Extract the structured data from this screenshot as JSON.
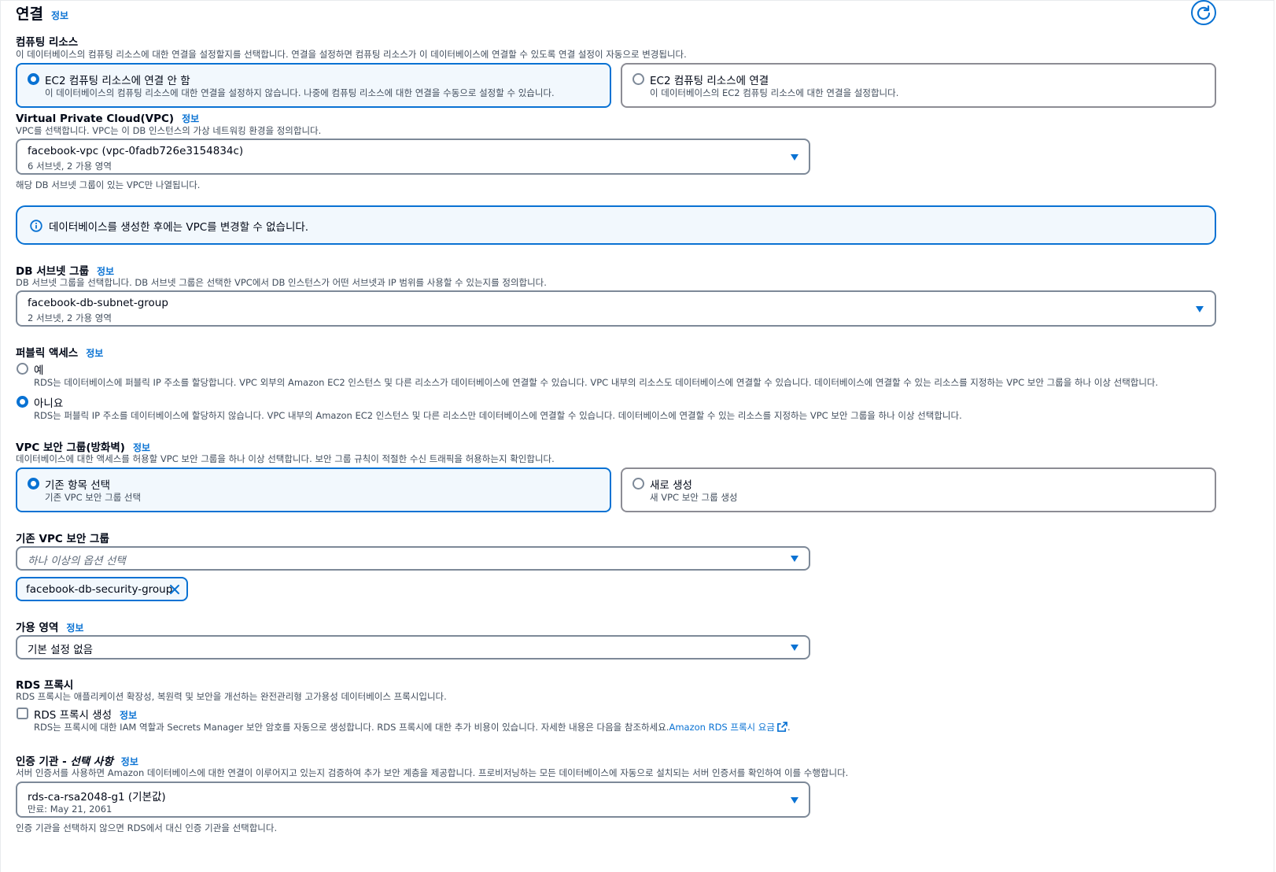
{
  "header": {
    "title": "연결",
    "info": "정보",
    "refresh_icon": "refresh-icon"
  },
  "compute": {
    "label": "컴퓨팅 리소스",
    "description": "이 데이터베이스의 컴퓨팅 리소스에 대한 연결을 설정할지를 선택합니다. 연결을 설정하면 컴퓨팅 리소스가 이 데이터베이스에 연결할 수 있도록 연결 설정이 자동으로 변경됩니다.",
    "options": [
      {
        "title": "EC2 컴퓨팅 리소스에 연결 안 함",
        "description": "이 데이터베이스의 컴퓨팅 리소스에 대한 연결을 설정하지 않습니다. 나중에 컴퓨팅 리소스에 대한 연결을 수동으로 설정할 수 있습니다.",
        "selected": true
      },
      {
        "title": "EC2 컴퓨팅 리소스에 연결",
        "description": "이 데이터베이스의 EC2 컴퓨팅 리소스에 대한 연결을 설정합니다.",
        "selected": false
      }
    ]
  },
  "vpc": {
    "label": "Virtual Private Cloud(VPC)",
    "info": "정보",
    "description": "VPC를 선택합니다. VPC는 이 DB 인스턴스의 가상 네트워킹 환경을 정의합니다.",
    "value": "facebook-vpc (vpc-0fadb726e3154834c)",
    "sub": "6 서브넷, 2 가용 영역",
    "hint": "해당 DB 서브넷 그룹이 있는 VPC만 나열됩니다.",
    "alert": "데이터베이스를 생성한 후에는 VPC를 변경할 수 없습니다."
  },
  "subnet": {
    "label": "DB 서브넷 그룹",
    "info": "정보",
    "description": "DB 서브넷 그룹을 선택합니다. DB 서브넷 그룹은 선택한 VPC에서 DB 인스턴스가 어떤 서브넷과 IP 범위를 사용할 수 있는지를 정의합니다.",
    "value": "facebook-db-subnet-group",
    "sub": "2 서브넷, 2 가용 영역"
  },
  "public_access": {
    "label": "퍼블릭 액세스",
    "info": "정보",
    "options": [
      {
        "title": "예",
        "description": "RDS는 데이터베이스에 퍼블릭 IP 주소를 할당합니다. VPC 외부의 Amazon EC2 인스턴스 및 다른 리소스가 데이터베이스에 연결할 수 있습니다. VPC 내부의 리소스도 데이터베이스에 연결할 수 있습니다. 데이터베이스에 연결할 수 있는 리소스를 지정하는 VPC 보안 그룹을 하나 이상 선택합니다.",
        "selected": false
      },
      {
        "title": "아니요",
        "description": "RDS는 퍼블릭 IP 주소를 데이터베이스에 할당하지 않습니다. VPC 내부의 Amazon EC2 인스턴스 및 다른 리소스만 데이터베이스에 연결할 수 있습니다. 데이터베이스에 연결할 수 있는 리소스를 지정하는 VPC 보안 그룹을 하나 이상 선택합니다.",
        "selected": true
      }
    ]
  },
  "security_group": {
    "label": "VPC 보안 그룹(방화벽)",
    "info": "정보",
    "description": "데이터베이스에 대한 액세스를 허용할 VPC 보안 그룹을 하나 이상 선택합니다. 보안 그룹 규칙이 적절한 수신 트래픽을 허용하는지 확인합니다.",
    "options": [
      {
        "title": "기존 항목 선택",
        "description": "기존 VPC 보안 그룹 선택",
        "selected": true
      },
      {
        "title": "새로 생성",
        "description": "새 VPC 보안 그룹 생성",
        "selected": false
      }
    ]
  },
  "existing_sg": {
    "label": "기존 VPC 보안 그룹",
    "placeholder": "하나 이상의 옵션 선택",
    "token": "facebook-db-security-group"
  },
  "az": {
    "label": "가용 영역",
    "info": "정보",
    "value": "기본 설정 없음"
  },
  "proxy": {
    "label": "RDS 프록시",
    "description": "RDS 프록시는 애플리케이션 확장성, 복원력 및 보안을 개선하는 완전관리형 고가용성 데이터베이스 프록시입니다.",
    "checkbox_label": "RDS 프록시 생성",
    "info": "정보",
    "checkbox_desc": "RDS는 프록시에 대한 IAM 역할과 Secrets Manager 보안 암호를 자동으로 생성합니다. RDS 프록시에 대한 추가 비용이 있습니다. 자세한 내용은 다음을 참조하세요.",
    "link": "Amazon RDS 프록시 요금",
    "period": ".",
    "checked": false
  },
  "ca": {
    "label_main": "인증 기관 - ",
    "label_italic": "선택 사항",
    "info": "정보",
    "description": "서버 인증서를 사용하면 Amazon 데이터베이스에 대한 연결이 이루어지고 있는지 검증하여 추가 보안 계층을 제공합니다. 프로비저닝하는 모든 데이터베이스에 자동으로 설치되는 서버 인증서를 확인하여 이를 수행합니다.",
    "value": "rds-ca-rsa2048-g1 (기본값)",
    "sub": "만료: May 21, 2061",
    "hint": "인증 기관을 선택하지 않으면 RDS에서 대신 인증 기관을 선택합니다."
  },
  "colors": {
    "accent": "#0972d3",
    "selected_bg": "#f2f8fd",
    "text": "#000716",
    "muted": "#414d5c"
  }
}
